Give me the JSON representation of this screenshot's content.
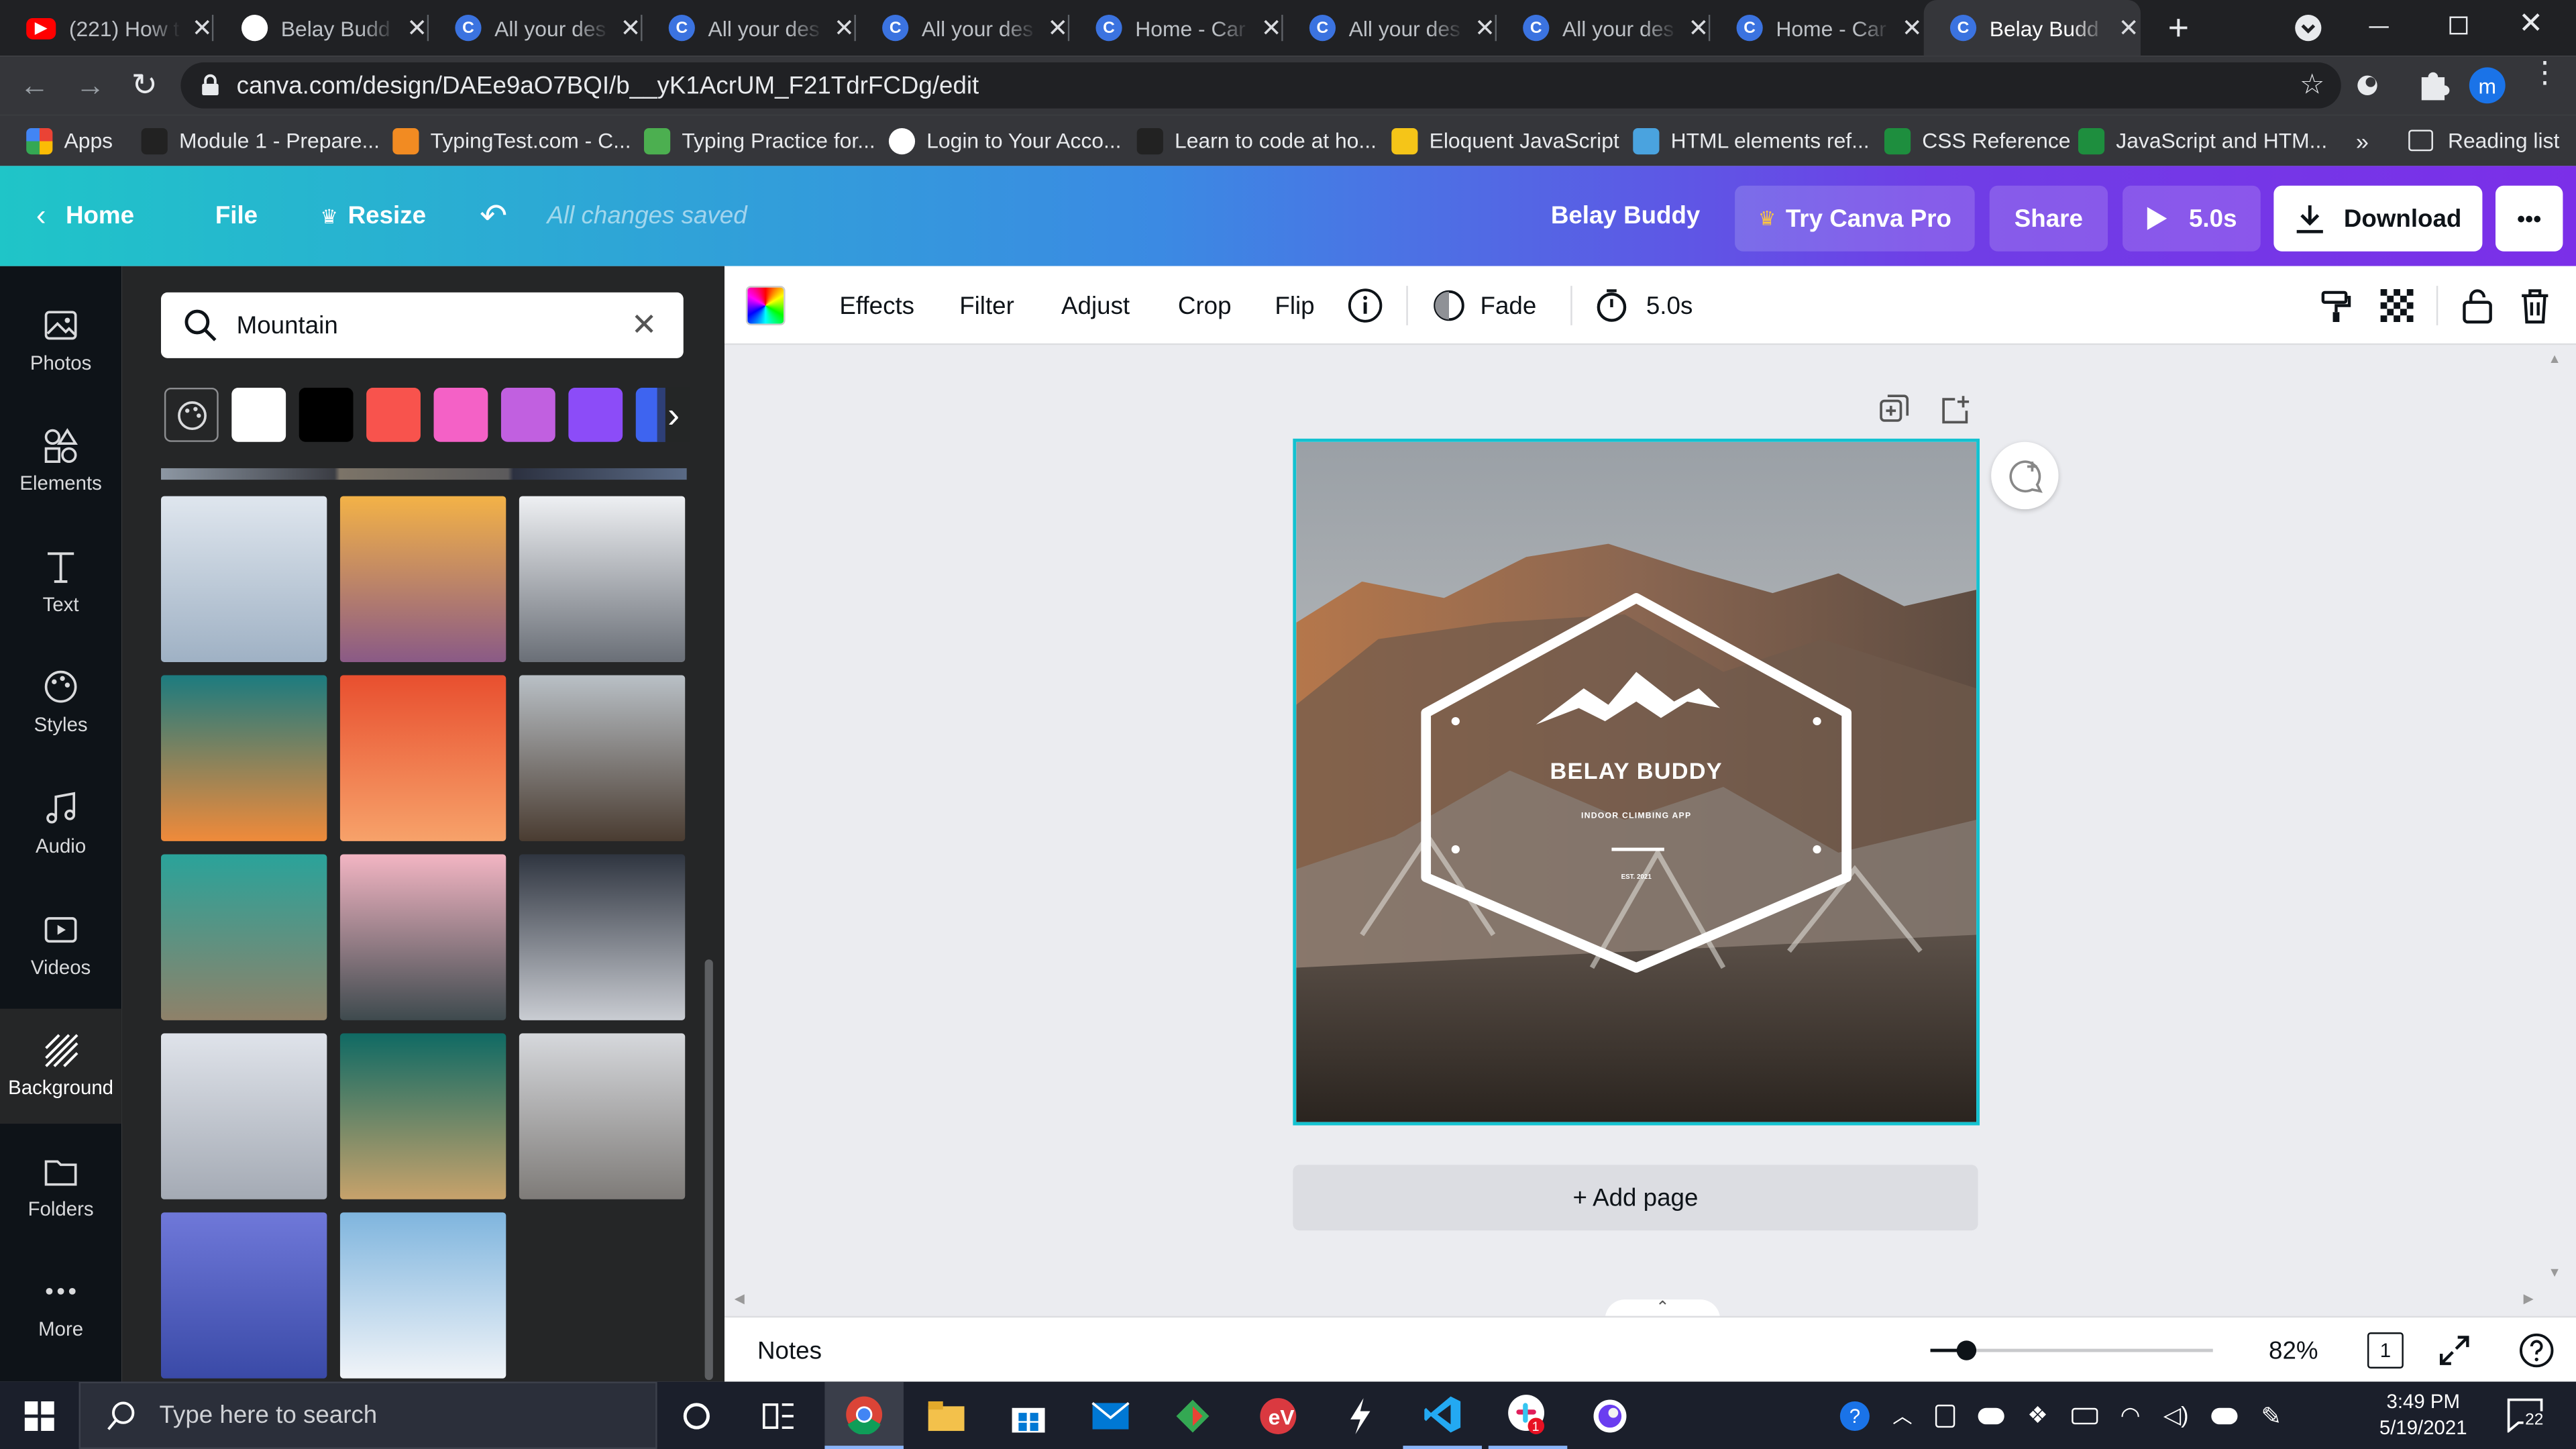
{
  "browser": {
    "tabs": [
      {
        "title": "(221) How t",
        "icon": "youtube-icon",
        "color": "#ff0000",
        "glyph": "▶"
      },
      {
        "title": "Belay Budd",
        "icon": "github-icon",
        "color": "#ffffff",
        "glyph": ""
      },
      {
        "title": "All your des",
        "icon": "canva-icon",
        "color": "#3b73e0",
        "glyph": "C"
      },
      {
        "title": "All your des",
        "icon": "canva-icon",
        "color": "#3b73e0",
        "glyph": "C"
      },
      {
        "title": "All your des",
        "icon": "canva-icon",
        "color": "#3b73e0",
        "glyph": "C"
      },
      {
        "title": "Home - Car",
        "icon": "canva-icon",
        "color": "#3b73e0",
        "glyph": "C"
      },
      {
        "title": "All your des",
        "icon": "canva-icon",
        "color": "#3b73e0",
        "glyph": "C"
      },
      {
        "title": "All your des",
        "icon": "canva-icon",
        "color": "#3b73e0",
        "glyph": "C"
      },
      {
        "title": "Home - Car",
        "icon": "canva-icon",
        "color": "#3b73e0",
        "glyph": "C"
      },
      {
        "title": "Belay Budd",
        "icon": "canva-icon",
        "color": "#3b73e0",
        "glyph": "C",
        "active": true
      }
    ],
    "url": "canva.com/design/DAEe9aO7BQI/b__yK1AcrUM_F21TdrFCDg/edit",
    "profile_initial": "m",
    "bookmarks": [
      {
        "label": "Apps",
        "icon": "apps-grid-icon"
      },
      {
        "label": "Module 1 - Prepare...",
        "icon": "bookmark-icon"
      },
      {
        "label": "TypingTest.com - C...",
        "icon": "typingtest-icon"
      },
      {
        "label": "Typing Practice for...",
        "icon": "typing-practice-icon"
      },
      {
        "label": "Login to Your Acco...",
        "icon": "globe-icon"
      },
      {
        "label": "Learn to code at ho...",
        "icon": "codecademy-icon"
      },
      {
        "label": "Eloquent JavaScript",
        "icon": "js-icon"
      },
      {
        "label": "HTML elements ref...",
        "icon": "mdn-icon"
      },
      {
        "label": "CSS Reference",
        "icon": "w3-icon"
      },
      {
        "label": "JavaScript and HTM...",
        "icon": "w3-icon"
      }
    ],
    "bookmarks_overflow": "»",
    "reading_list": "Reading list"
  },
  "header": {
    "home": "Home",
    "file": "File",
    "resize": "Resize",
    "status": "All changes saved",
    "design_title": "Belay Buddy",
    "try_pro": "Try Canva Pro",
    "share": "Share",
    "play_duration": "5.0s",
    "download": "Download",
    "more": "•••"
  },
  "rail": [
    {
      "label": "Photos",
      "icon": "photos-icon"
    },
    {
      "label": "Elements",
      "icon": "elements-icon"
    },
    {
      "label": "Text",
      "icon": "text-icon"
    },
    {
      "label": "Styles",
      "icon": "styles-icon"
    },
    {
      "label": "Audio",
      "icon": "audio-icon"
    },
    {
      "label": "Videos",
      "icon": "videos-icon"
    },
    {
      "label": "Background",
      "icon": "background-icon",
      "active": true
    },
    {
      "label": "Folders",
      "icon": "folders-icon"
    },
    {
      "label": "More",
      "icon": "more-icon"
    }
  ],
  "panel": {
    "search_value": "Mountain",
    "swatches": [
      "#ffffff",
      "#000000",
      "#f8534d",
      "#f461c6",
      "#c160e0",
      "#8c4cf8",
      "#3e64f0"
    ],
    "thumbnails": [
      {
        "name": "clouds-over-mountains",
        "colors": [
          "#dfe6ee",
          "#9fb1c4"
        ]
      },
      {
        "name": "sunset-hazy-ridges",
        "colors": [
          "#f3b247",
          "#8a5a86"
        ]
      },
      {
        "name": "snowy-peaks",
        "colors": [
          "#eef0f3",
          "#6a6f77"
        ]
      },
      {
        "name": "orange-horizon",
        "colors": [
          "#1c7b7f",
          "#f08a3a"
        ]
      },
      {
        "name": "canyon-swirls",
        "colors": [
          "#e84f2f",
          "#f7a26a"
        ]
      },
      {
        "name": "rocky-mountain",
        "colors": [
          "#b9c0c6",
          "#4a3c31"
        ]
      },
      {
        "name": "turquoise-water-cliff",
        "colors": [
          "#2aa39a",
          "#8f8169"
        ]
      },
      {
        "name": "pink-sky-mountains",
        "colors": [
          "#f3b5c3",
          "#3e4a4e"
        ]
      },
      {
        "name": "night-snow-slopes",
        "colors": [
          "#2f3540",
          "#c9ccd2"
        ]
      },
      {
        "name": "snow-valley",
        "colors": [
          "#dfe3ea",
          "#a4aab4"
        ]
      },
      {
        "name": "aerial-coast",
        "colors": [
          "#0f6a64",
          "#c7a26b"
        ]
      },
      {
        "name": "misty-snow-hills",
        "colors": [
          "#d6d8dc",
          "#7e7b78"
        ]
      },
      {
        "name": "purple-half-dome",
        "colors": [
          "#6f78d9",
          "#3a4aa7"
        ]
      },
      {
        "name": "snow-dunes-blue-sky",
        "colors": [
          "#7fb5de",
          "#f1f4f8"
        ]
      }
    ]
  },
  "toolbar": {
    "effects": "Effects",
    "filter": "Filter",
    "adjust": "Adjust",
    "crop": "Crop",
    "flip": "Flip",
    "fade": "Fade",
    "duration": "5.0s"
  },
  "design": {
    "logo_title": "BELAY BUDDY",
    "logo_subtitle": "INDOOR CLIMBING APP",
    "logo_est": "EST. 2021"
  },
  "canvas": {
    "add_page": "+ Add page"
  },
  "footer": {
    "notes": "Notes",
    "zoom": "82%",
    "page_count": "1",
    "zoom_level": 0.13
  },
  "taskbar": {
    "search_placeholder": "Type here to search",
    "time": "3:49 PM",
    "date": "5/19/2021",
    "notification_count": "22"
  }
}
